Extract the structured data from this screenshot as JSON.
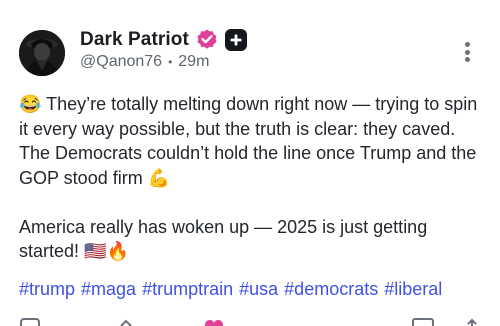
{
  "post": {
    "author": {
      "display_name": "Dark Patriot",
      "handle": "@Qanon76",
      "separator": "•",
      "time_ago": "29m",
      "avatar_icon": "hooded-figure-avatar",
      "verified_badge_color": "#e0409a",
      "plus_badge_color": "#15181d"
    },
    "paragraphs": [
      "😂 They’re totally melting down right now — trying to spin it every way possible, but the truth is clear: they caved. The Democrats couldn’t hold the line once Trump and the GOP stood firm 💪",
      "America really has woken up — 2025 is just getting started! 🇺🇸🔥"
    ],
    "hashtags": [
      "#trump",
      "#maga",
      "#trumptrain",
      "#usa",
      "#democrats",
      "#liberal"
    ],
    "colors": {
      "hashtag": "#4051e6",
      "text": "#23272d",
      "muted": "#5f6670",
      "like": "#e0409a"
    }
  }
}
